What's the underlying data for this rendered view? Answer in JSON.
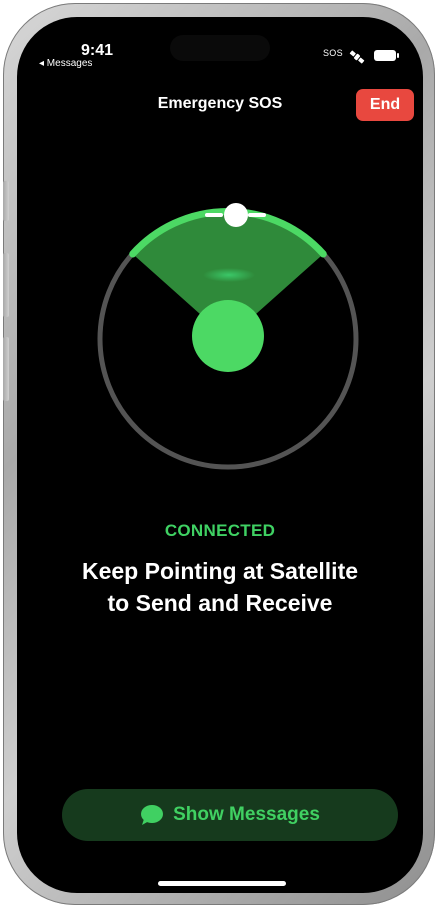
{
  "status_bar": {
    "time": "9:41",
    "back_app": "◂ Messages",
    "sos_label": "SOS",
    "icons": [
      "satellite-icon",
      "battery-icon"
    ]
  },
  "header": {
    "title": "Emergency SOS",
    "end_label": "End"
  },
  "radar": {
    "state": "connected",
    "ring_color": "#545454",
    "arc_color": "#4cd964",
    "target_color": "#4cd964",
    "icons": [
      "satellite-marker-icon"
    ]
  },
  "status_text": "CONNECTED",
  "headline": {
    "line1": "Keep Pointing at Satellite",
    "line2": "to Send and Receive"
  },
  "bottom_button": {
    "label": "Show Messages",
    "icon": "message-bubble-icon"
  },
  "colors": {
    "accent_green": "#3fd163",
    "end_red": "#e8483f",
    "background": "#000000"
  }
}
